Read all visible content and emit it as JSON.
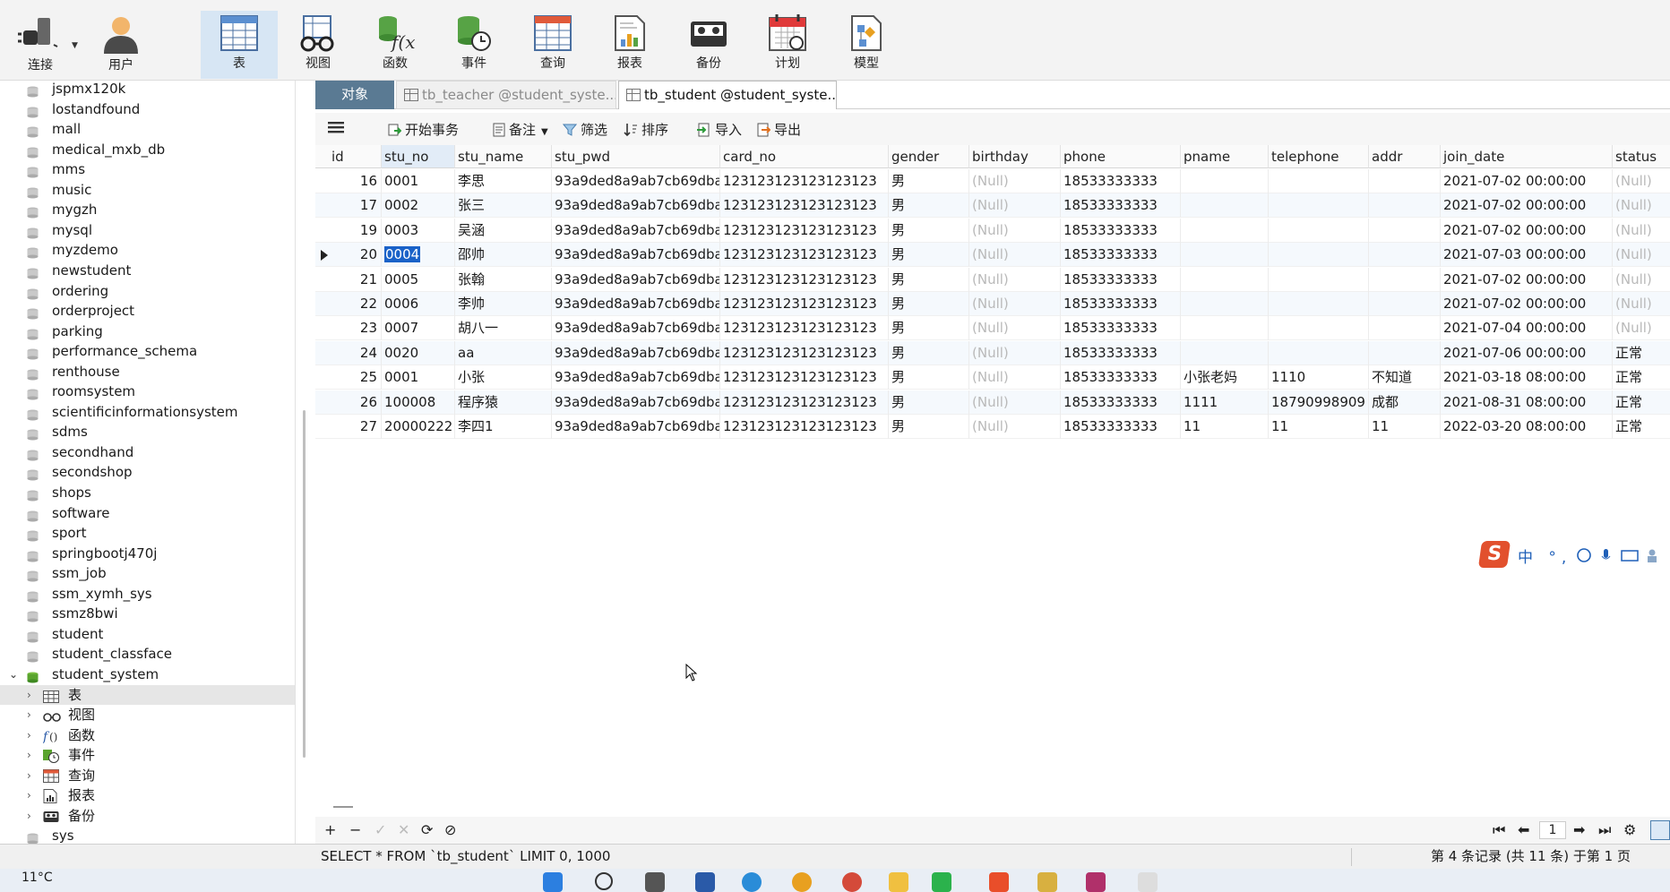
{
  "toolbar": {
    "buttons": [
      {
        "label": "连接",
        "icon": "plug-icon"
      },
      {
        "label": "用户",
        "icon": "user-icon"
      },
      {
        "label": "表",
        "icon": "table-icon"
      },
      {
        "label": "视图",
        "icon": "view-icon"
      },
      {
        "label": "函数",
        "icon": "function-icon"
      },
      {
        "label": "事件",
        "icon": "event-icon"
      },
      {
        "label": "查询",
        "icon": "query-icon"
      },
      {
        "label": "报表",
        "icon": "report-icon"
      },
      {
        "label": "备份",
        "icon": "backup-icon"
      },
      {
        "label": "计划",
        "icon": "schedule-icon"
      },
      {
        "label": "模型",
        "icon": "model-icon"
      }
    ]
  },
  "sidebar": {
    "databases": [
      "jspmx120k",
      "lostandfound",
      "mall",
      "medical_mxb_db",
      "mms",
      "music",
      "mygzh",
      "mysql",
      "myzdemo",
      "newstudent",
      "ordering",
      "orderproject",
      "parking",
      "performance_schema",
      "renthouse",
      "roomsystem",
      "scientificinformationsystem",
      "sdms",
      "secondhand",
      "secondshop",
      "shops",
      "software",
      "sport",
      "springbootj470j",
      "ssm_job",
      "ssm_xymh_sys",
      "ssmz8bwi",
      "student",
      "student_classface"
    ],
    "open_db": "student_system",
    "children": [
      "表",
      "视图",
      "函数",
      "事件",
      "查询",
      "报表",
      "备份"
    ],
    "last_db": "sys"
  },
  "tabs": {
    "objects": "对象",
    "teacher": "tb_teacher @student_syste...",
    "student": "tb_student @student_syste..."
  },
  "subtoolbar": {
    "begin_tx": "开始事务",
    "memo": "备注",
    "filter": "筛选",
    "sort": "排序",
    "import": "导入",
    "export": "导出"
  },
  "grid": {
    "columns": [
      "id",
      "stu_no",
      "stu_name",
      "stu_pwd",
      "card_no",
      "gender",
      "birthday",
      "phone",
      "pname",
      "telephone",
      "addr",
      "join_date",
      "status"
    ],
    "rows": [
      [
        "16",
        "0001",
        "李思",
        "93a9ded8a9ab7cb69dba(",
        "123123123123123123",
        "男",
        "(Null)",
        "18533333333",
        "",
        "",
        "",
        "2021-07-02 00:00:00",
        "(Null)"
      ],
      [
        "17",
        "0002",
        "张三",
        "93a9ded8a9ab7cb69dba(",
        "123123123123123123",
        "男",
        "(Null)",
        "18533333333",
        "",
        "",
        "",
        "2021-07-02 00:00:00",
        "(Null)"
      ],
      [
        "19",
        "0003",
        "吴涵",
        "93a9ded8a9ab7cb69dba(",
        "123123123123123123",
        "男",
        "(Null)",
        "18533333333",
        "",
        "",
        "",
        "2021-07-02 00:00:00",
        "(Null)"
      ],
      [
        "20",
        "0004",
        "邵帅",
        "93a9ded8a9ab7cb69dba(",
        "123123123123123123",
        "男",
        "(Null)",
        "18533333333",
        "",
        "",
        "",
        "2021-07-03 00:00:00",
        "(Null)"
      ],
      [
        "21",
        "0005",
        "张翰",
        "93a9ded8a9ab7cb69dba(",
        "123123123123123123",
        "男",
        "(Null)",
        "18533333333",
        "",
        "",
        "",
        "2021-07-02 00:00:00",
        "(Null)"
      ],
      [
        "22",
        "0006",
        "李帅",
        "93a9ded8a9ab7cb69dba(",
        "123123123123123123",
        "男",
        "(Null)",
        "18533333333",
        "",
        "",
        "",
        "2021-07-02 00:00:00",
        "(Null)"
      ],
      [
        "23",
        "0007",
        "胡八一",
        "93a9ded8a9ab7cb69dba(",
        "123123123123123123",
        "男",
        "(Null)",
        "18533333333",
        "",
        "",
        "",
        "2021-07-04 00:00:00",
        "(Null)"
      ],
      [
        "24",
        "0020",
        "aa",
        "93a9ded8a9ab7cb69dba(",
        "123123123123123123",
        "男",
        "(Null)",
        "18533333333",
        "",
        "",
        "",
        "2021-07-06 00:00:00",
        "正常"
      ],
      [
        "25",
        "0001",
        "小张",
        "93a9ded8a9ab7cb69dba(",
        "123123123123123123",
        "男",
        "(Null)",
        "18533333333",
        "小张老妈",
        "1110",
        "不知道",
        "2021-03-18 08:00:00",
        "正常"
      ],
      [
        "26",
        "100008",
        "程序猿",
        "93a9ded8a9ab7cb69dba(",
        "123123123123123123",
        "男",
        "(Null)",
        "18533333333",
        "1111",
        "18790998909",
        "成都",
        "2021-08-31 08:00:00",
        "正常"
      ],
      [
        "27",
        "20000222",
        "李四1",
        "93a9ded8a9ab7cb69dba(",
        "123123123123123123",
        "男",
        "(Null)",
        "18533333333",
        "11",
        "11",
        "11",
        "2022-03-20 08:00:00",
        "正常"
      ]
    ],
    "selected_row": 3,
    "selected_col": 1
  },
  "footer": {
    "page": "1"
  },
  "statusbar": {
    "sql": "SELECT * FROM `tb_student` LIMIT 0, 1000",
    "record_info": "第 4 条记录 (共 11 条) 于第 1 页"
  },
  "taskbar": {
    "weather": "11°C"
  },
  "ime": {
    "text": "中 °,"
  }
}
